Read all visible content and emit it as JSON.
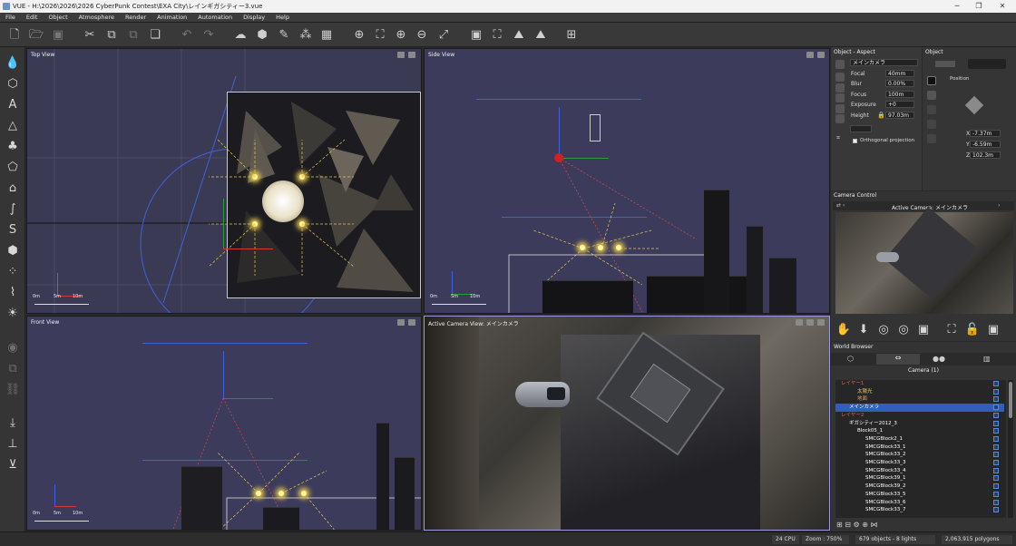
{
  "window": {
    "title": "VUE - H:\\2026\\2026\\2026 CyberPunk Contest\\EXA City\\レインギガシティー3.vue"
  },
  "menu": [
    "File",
    "Edit",
    "Object",
    "Atmosphere",
    "Render",
    "Animation",
    "Automation",
    "Display",
    "Help"
  ],
  "viewports": {
    "top": {
      "label": "Top View",
      "scale": [
        "0m",
        "5m",
        "10m"
      ]
    },
    "side": {
      "label": "Side View",
      "scale": [
        "0m",
        "5m",
        "10m"
      ]
    },
    "front": {
      "label": "Front View",
      "scale": [
        "0m",
        "5m",
        "10m"
      ]
    },
    "camera": {
      "label": "Active Camera View: メインカメラ"
    }
  },
  "aspect": {
    "header": "Object - Aspect",
    "camera_select": "メインカメラ",
    "focal": {
      "label": "Focal",
      "value": "40mm"
    },
    "blur": {
      "label": "Blur",
      "value": "0.00%"
    },
    "focus": {
      "label": "Focus",
      "value": "100m"
    },
    "exposure": {
      "label": "Exposure",
      "value": "+0"
    },
    "height": {
      "label": "Height",
      "value": "97.03m"
    },
    "ortho": "Orthogonal projection"
  },
  "object": {
    "header": "Object",
    "position_label": "Position",
    "x": {
      "label": "X",
      "value": "-7.37m"
    },
    "y": {
      "label": "Y",
      "value": "-6.59m"
    },
    "z": {
      "label": "Z",
      "value": "102.3m"
    }
  },
  "camera_control": {
    "header": "Camera Control",
    "active": "Active Camera: メインカメラ"
  },
  "world_browser": {
    "header": "World Browser",
    "tab_title": "Camera (1)",
    "items": [
      {
        "indent": 0,
        "text": "レイヤー1",
        "color": "#e06060"
      },
      {
        "indent": 2,
        "text": "太陽光",
        "color": "#f0d060"
      },
      {
        "indent": 2,
        "text": "地面",
        "color": "#e0a060"
      },
      {
        "indent": 1,
        "text": "メインカメラ",
        "color": "#ffffff",
        "selected": true
      },
      {
        "indent": 0,
        "text": "レイヤー2",
        "color": "#e06060"
      },
      {
        "indent": 1,
        "text": "ギガシティー2012_3",
        "color": "#ffffff"
      },
      {
        "indent": 2,
        "text": "Block05_1",
        "color": "#ffffff"
      },
      {
        "indent": 3,
        "text": "SMCGBlock2_1",
        "color": "#ffffff"
      },
      {
        "indent": 3,
        "text": "SMCGBlock33_1",
        "color": "#ffffff"
      },
      {
        "indent": 3,
        "text": "SMCGBlock33_2",
        "color": "#ffffff"
      },
      {
        "indent": 3,
        "text": "SMCGBlock33_3",
        "color": "#ffffff"
      },
      {
        "indent": 3,
        "text": "SMCGBlock33_4",
        "color": "#ffffff"
      },
      {
        "indent": 3,
        "text": "SMCGBlock39_1",
        "color": "#ffffff"
      },
      {
        "indent": 3,
        "text": "SMCGBlock39_2",
        "color": "#ffffff"
      },
      {
        "indent": 3,
        "text": "SMCGBlock33_5",
        "color": "#ffffff"
      },
      {
        "indent": 3,
        "text": "SMCGBlock33_6",
        "color": "#ffffff"
      },
      {
        "indent": 3,
        "text": "SMCGBlock33_7",
        "color": "#ffffff"
      }
    ]
  },
  "status": {
    "cpu": "24 CPU",
    "zoom": "Zoom : 750%",
    "objects": "679 objects - 8 lights",
    "polygons": "2,063,915 polygons"
  }
}
